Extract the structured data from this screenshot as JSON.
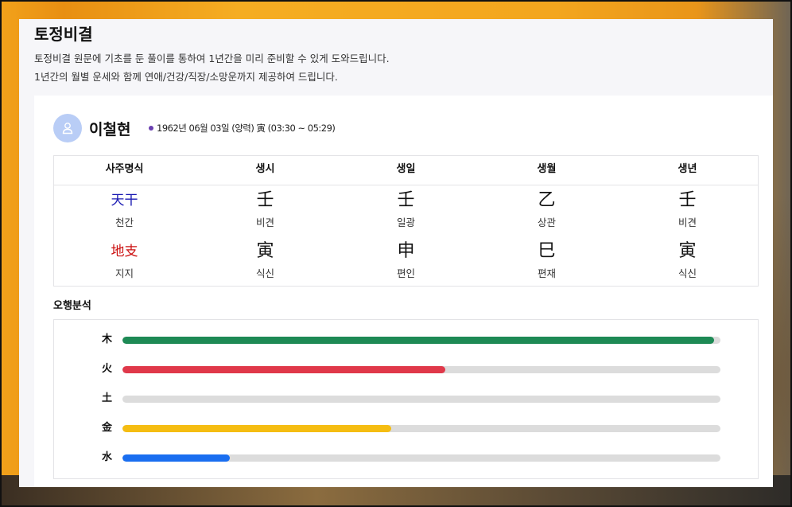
{
  "header": {
    "title": "토정비결",
    "description_1": "토정비결 원문에 기초를 둔 풀이를 통하여 1년간을 미리 준비할 수 있게 도와드립니다.",
    "description_2": "1년간의 월별 운세와 함께 연애/건강/직장/소망운까지 제공하여 드립니다."
  },
  "profile": {
    "name": "이철현",
    "birth": "1962년 06월 03일 (양력) 寅 (03:30 ~ 05:29)"
  },
  "saju": {
    "headers": [
      "사주명식",
      "생시",
      "생일",
      "생월",
      "생년"
    ],
    "rows": [
      {
        "label_hanja": "天干",
        "label_ko": "천간",
        "label_color": "#1b1bb3",
        "cells": [
          {
            "hanja": "壬",
            "ko": "비견"
          },
          {
            "hanja": "壬",
            "ko": "일광"
          },
          {
            "hanja": "乙",
            "ko": "상관"
          },
          {
            "hanja": "壬",
            "ko": "비견"
          }
        ]
      },
      {
        "label_hanja": "地支",
        "label_ko": "지지",
        "label_color": "#cc1111",
        "cells": [
          {
            "hanja": "寅",
            "ko": "식신"
          },
          {
            "hanja": "申",
            "ko": "편인"
          },
          {
            "hanja": "巳",
            "ko": "편재"
          },
          {
            "hanja": "寅",
            "ko": "식신"
          }
        ]
      }
    ]
  },
  "ohang": {
    "title": "오행분석",
    "elements": [
      {
        "label": "木",
        "fraction": 0.99,
        "color": "#1e8a55"
      },
      {
        "label": "火",
        "fraction": 0.54,
        "color": "#e0384a"
      },
      {
        "label": "土",
        "fraction": 0.0,
        "color": "#999999"
      },
      {
        "label": "金",
        "fraction": 0.45,
        "color": "#f5bd12"
      },
      {
        "label": "水",
        "fraction": 0.18,
        "color": "#1a6ef0"
      }
    ]
  },
  "icons": {
    "avatar": "user-icon"
  }
}
